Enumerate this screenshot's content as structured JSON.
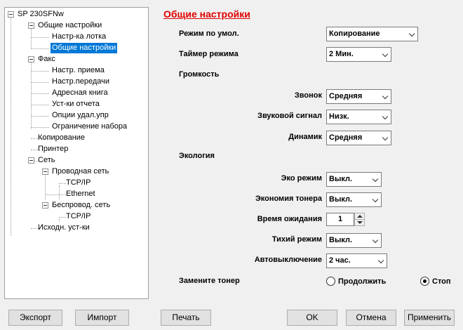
{
  "tree": {
    "root": "SP 230SFNw",
    "items": [
      "Общие настройки",
      "Настр-ка лотка",
      "Общие настройки",
      "Факс",
      "Настр. приема",
      "Настр.передачи",
      "Адресная книга",
      "Уст-ки отчета",
      "Опции удал.упр",
      "Ограничение набора",
      "Копирование",
      "Принтер",
      "Сеть",
      "Проводная сеть",
      "TCP/IP",
      "Ethernet",
      "Беспровод. сеть",
      "TCP/IP",
      "Исходн. уст-ки"
    ]
  },
  "panel": {
    "title": "Общие настройки",
    "default_mode_label": "Режим по умол.",
    "default_mode_value": "Копирование",
    "mode_timer_label": "Таймер режима",
    "mode_timer_value": "2 Мин.",
    "volume_label": "Громкость",
    "ring_label": "Звонок",
    "ring_value": "Средняя",
    "beep_label": "Звуковой сигнал",
    "beep_value": "Низк.",
    "speaker_label": "Динамик",
    "speaker_value": "Средняя",
    "ecology_label": "Экология",
    "eco_mode_label": "Эко режим",
    "eco_mode_value": "Выкл.",
    "toner_save_label": "Экономия тонера",
    "toner_save_value": "Выкл.",
    "sleep_time_label": "Время ожидания",
    "sleep_time_value": "1",
    "quiet_mode_label": "Тихий режим",
    "quiet_mode_value": "Выкл.",
    "auto_off_label": "Автовыключение",
    "auto_off_value": "2 час.",
    "replace_toner_label": "Замените тонер",
    "continue_label": "Продолжить",
    "stop_label": "Стоп",
    "selected_option": "Стоп"
  },
  "buttons": {
    "export": "Экспорт",
    "import": "Импорт",
    "print": "Печать",
    "ok": "OK",
    "cancel": "Отмена",
    "apply": "Применить"
  }
}
